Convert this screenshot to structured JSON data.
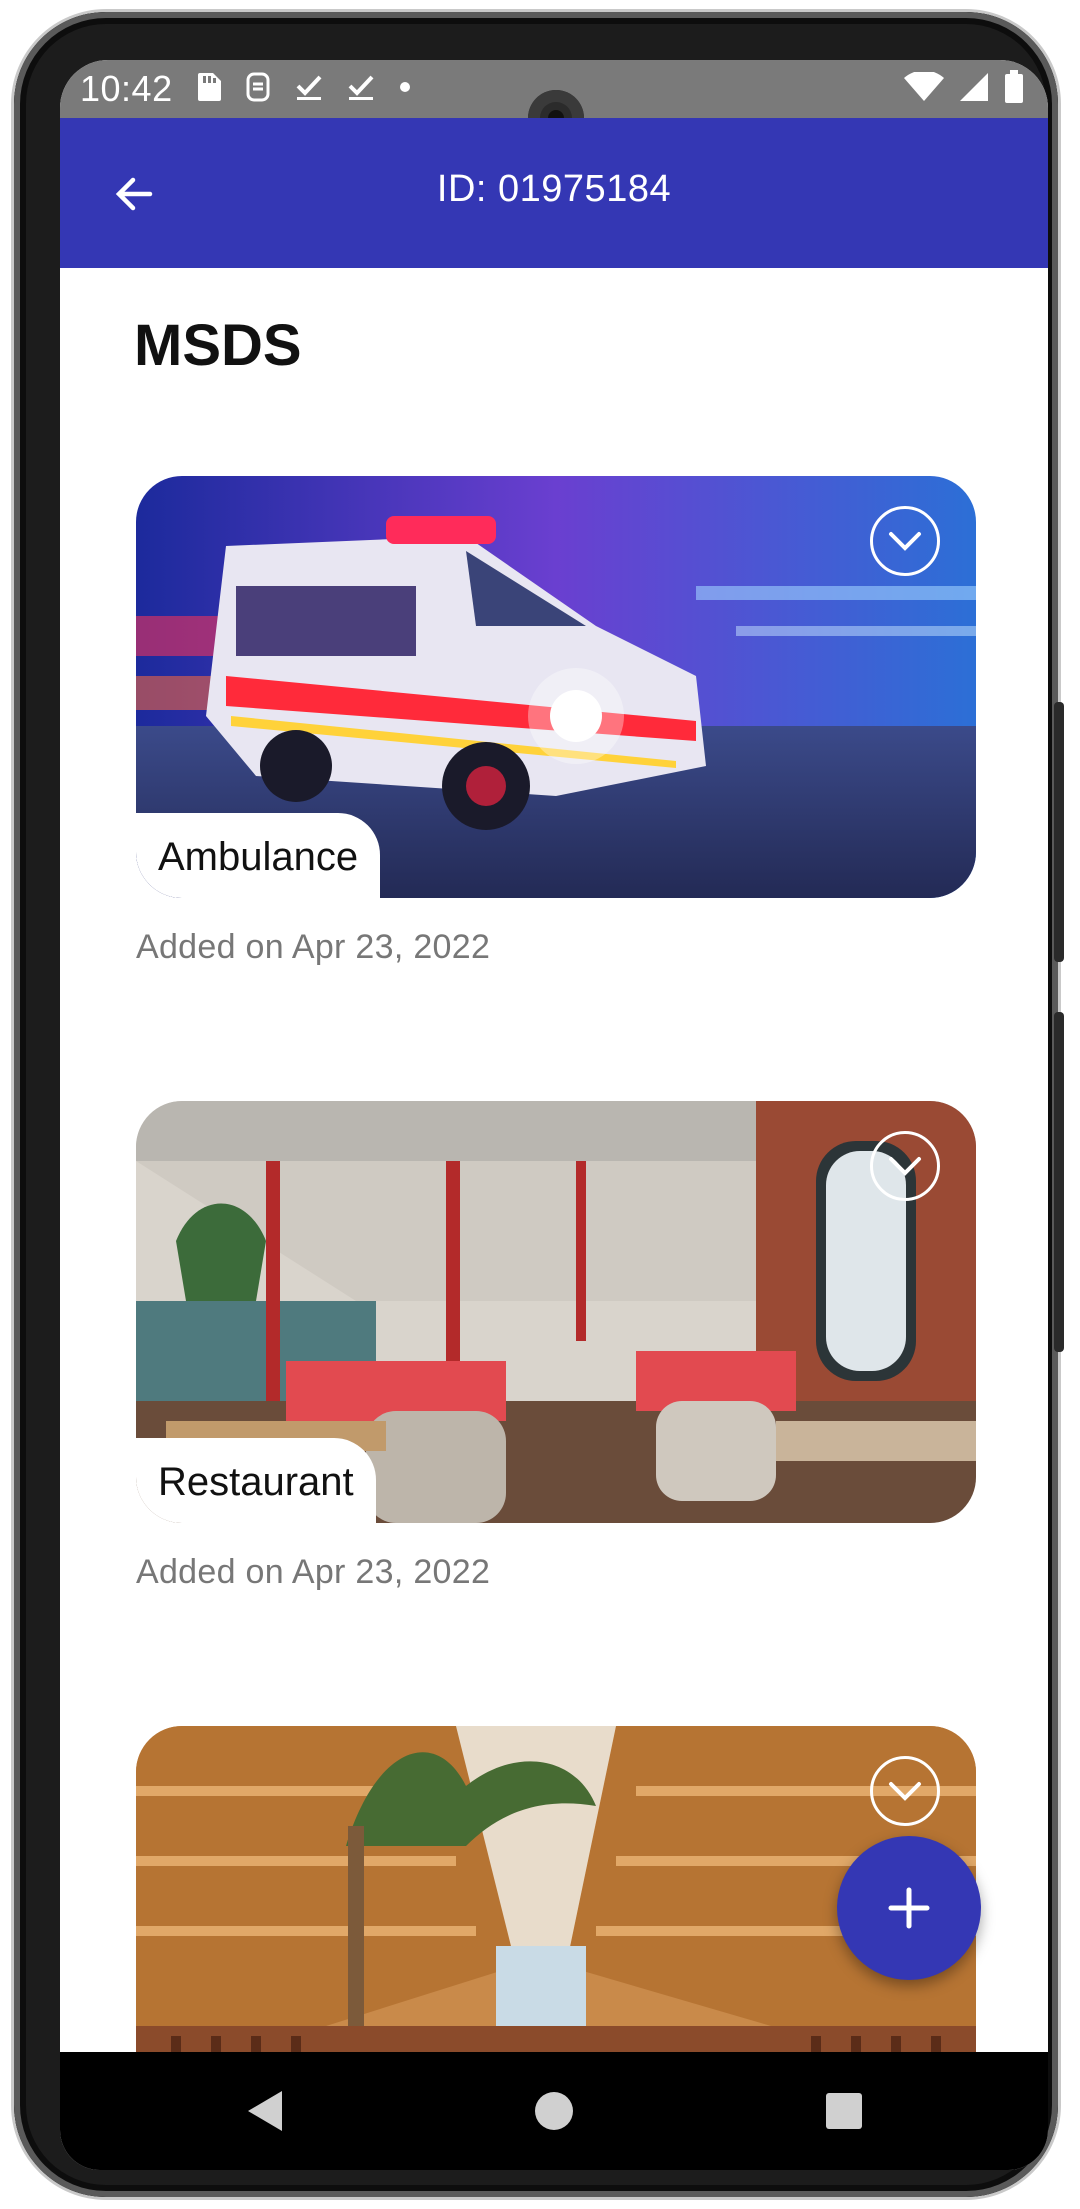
{
  "status_bar": {
    "time": "10:42",
    "left_icons": [
      "sd-card-icon",
      "notification-icon",
      "check-icon",
      "check-icon",
      "dot-icon"
    ],
    "right_icons": [
      "wifi-icon",
      "signal-icon",
      "battery-icon"
    ]
  },
  "app_bar": {
    "title": "ID: 01975184",
    "background": "#3437b4",
    "back_icon": "arrow-back-icon"
  },
  "page": {
    "title": "MSDS"
  },
  "cards": [
    {
      "label": "Ambulance",
      "date": "Added on Apr 23, 2022",
      "image": "ambulance-photo",
      "toggle_icon": "chevron-down-circle-icon"
    },
    {
      "label": "Restaurant",
      "date": "Added on Apr 23, 2022",
      "image": "restaurant-photo",
      "toggle_icon": "chevron-down-circle-icon"
    },
    {
      "label": "",
      "date": "",
      "image": "atrium-photo",
      "toggle_icon": "chevron-down-circle-icon"
    }
  ],
  "fab": {
    "icon": "plus-icon",
    "color": "#3437b4"
  },
  "nav_bar": {
    "buttons": [
      "back-triangle-icon",
      "home-circle-icon",
      "recents-square-icon"
    ]
  }
}
